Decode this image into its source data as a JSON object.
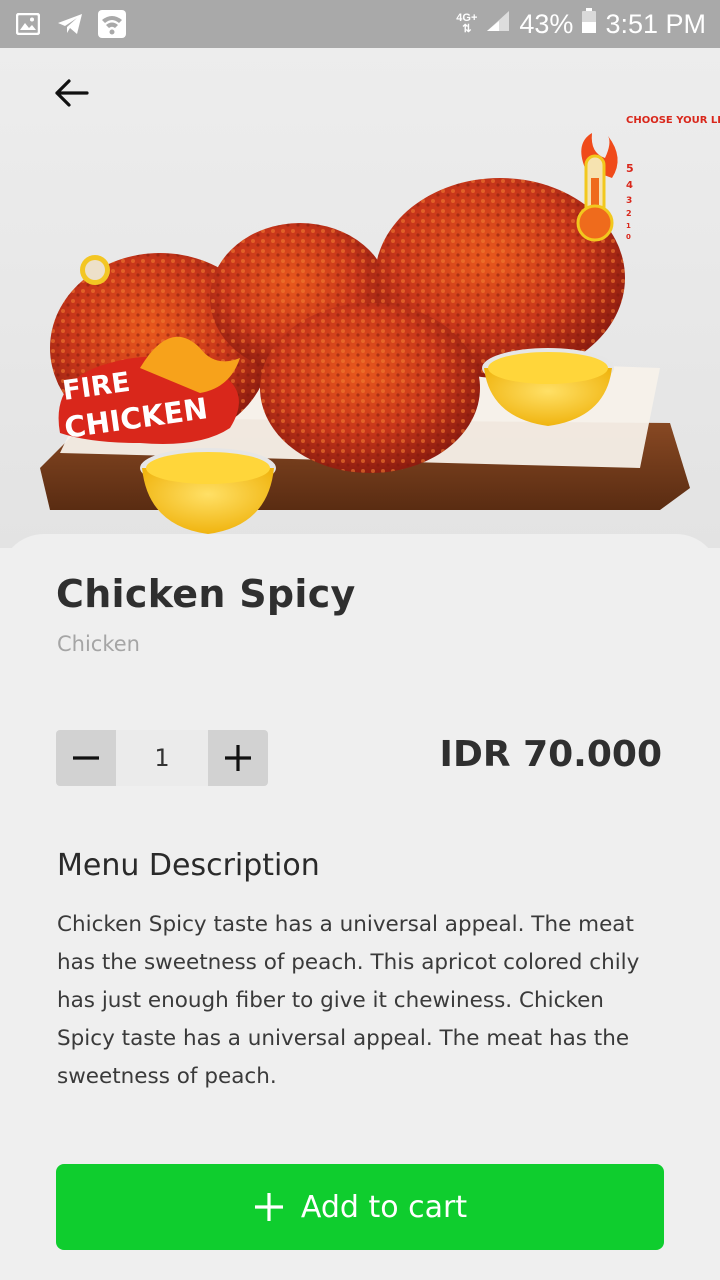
{
  "status_bar": {
    "network": "4G+",
    "battery": "43%",
    "time": "3:51 PM"
  },
  "hero": {
    "badge_line1": "FIRE",
    "badge_line2": "CHICKEN",
    "level_heading": "CHOOSE YOUR LEVEL!!",
    "level_numbers": [
      "5",
      "4",
      "3",
      "2",
      "1",
      "0"
    ]
  },
  "product": {
    "name": "Chicken Spicy",
    "category": "Chicken",
    "quantity": "1",
    "price": "IDR 70.000"
  },
  "description": {
    "heading": "Menu Description",
    "text": "Chicken Spicy taste has a universal appeal. The meat has the sweetness of peach. This apricot colored chily has just enough fiber to give it chewiness. Chicken Spicy taste has a universal appeal. The meat has the sweetness of peach."
  },
  "actions": {
    "add_to_cart": "Add to cart"
  },
  "colors": {
    "accent": "#0fcd2e",
    "status_bar": "#a9a9a9"
  }
}
